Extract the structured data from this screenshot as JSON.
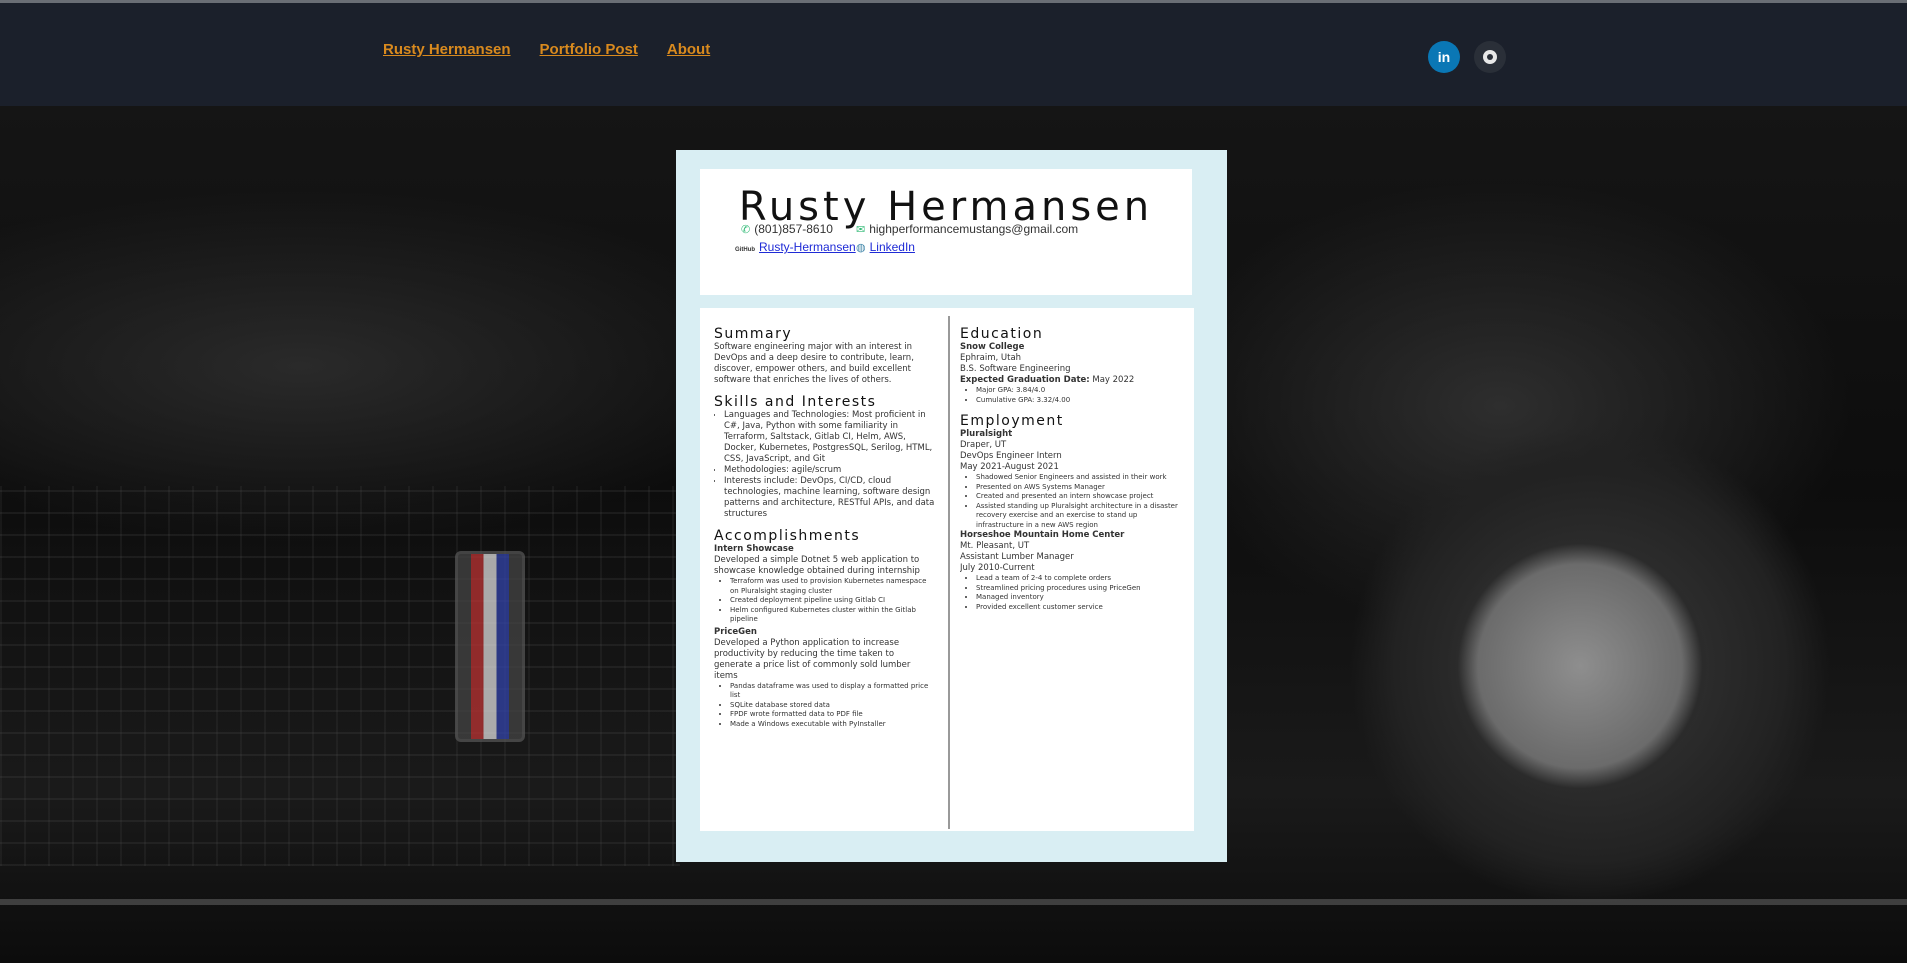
{
  "nav": {
    "items": [
      "Rusty Hermansen",
      "Portfolio Post",
      "About"
    ]
  },
  "social": {
    "linkedin_label": "in",
    "icons": [
      "linkedin-icon",
      "github-icon"
    ]
  },
  "resume": {
    "name": "Rusty Hermansen",
    "phone": "(801)857-8610",
    "email": "highperformancemustangs@gmail.com",
    "github_tag": "GitHub",
    "github_link": "Rusty-Hermansen",
    "linkedin_link": "LinkedIn",
    "summary": {
      "heading": "Summary",
      "text": "Software engineering major with an interest in DevOps and a deep desire to contribute, learn, discover, empower others, and build excellent software that enriches the lives of others."
    },
    "skills": {
      "heading": "Skills and Interests",
      "items": [
        "Languages and Technologies: Most proficient in C#, Java, Python with some familiarity in Terraform, Saltstack, Gitlab CI, Helm, AWS, Docker, Kubernetes, PostgresSQL, Serilog, HTML, CSS, JavaScript, and Git",
        "Methodologies: agile/scrum",
        "Interests include: DevOps, CI/CD, cloud technologies, machine learning, software design patterns and architecture, RESTful APIs, and data structures"
      ]
    },
    "accomplishments": {
      "heading": "Accomplishments",
      "projects": [
        {
          "title": "Intern Showcase",
          "desc": "Developed a simple Dotnet 5 web application to showcase knowledge obtained during internship",
          "bullets": [
            "Terraform was used to provision Kubernetes namespace on Pluralsight staging cluster",
            "Created deployment pipeline using Gitlab CI",
            "Helm configured Kubernetes cluster within the Gitlab pipeline"
          ]
        },
        {
          "title": "PriceGen",
          "desc": "Developed a Python application to increase productivity by reducing the time taken to generate a price list of commonly sold lumber items",
          "bullets": [
            "Pandas dataframe was used to display a formatted price list",
            "SQLite database stored data",
            "FPDF wrote formatted data to PDF file",
            "Made a Windows executable with PyInstaller"
          ]
        }
      ]
    },
    "education": {
      "heading": "Education",
      "school": "Snow College",
      "location": "Ephraim, Utah",
      "degree": "B.S. Software Engineering",
      "grad_label": "Expected Graduation Date:",
      "grad_date": "May 2022",
      "bullets": [
        "Major GPA: 3.84/4.0",
        "Cumulative GPA: 3.32/4.00"
      ]
    },
    "employment": {
      "heading": "Employment",
      "jobs": [
        {
          "company": "Pluralsight",
          "location": "Draper, UT",
          "title": "DevOps Engineer Intern",
          "dates": "May 2021-August 2021",
          "bullets": [
            "Shadowed Senior Engineers and assisted in their work",
            "Presented on AWS Systems Manager",
            "Created and presented an intern showcase project",
            "Assisted standing up Pluralsight architecture in a disaster recovery exercise and an exercise to stand up infrastructure in a new AWS region"
          ]
        },
        {
          "company": "Horseshoe Mountain Home Center",
          "location": "Mt. Pleasant, UT",
          "title": "Assistant Lumber Manager",
          "dates": "July 2010-Current",
          "bullets": [
            "Lead a team of 2-4 to complete orders",
            "Streamlined pricing procedures using PriceGen",
            "Managed inventory",
            "Provided excellent customer service"
          ]
        }
      ]
    }
  }
}
